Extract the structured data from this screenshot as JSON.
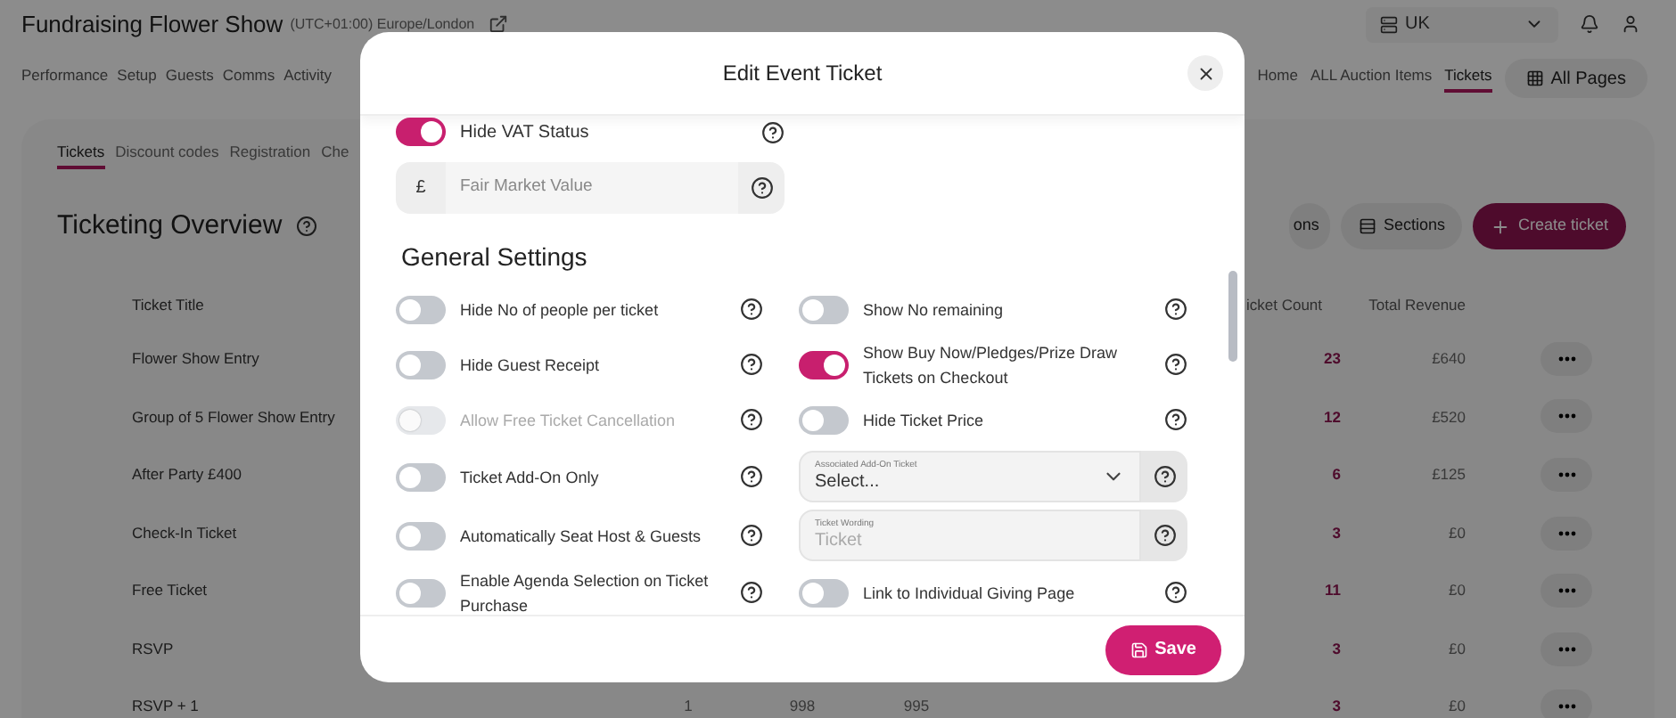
{
  "header": {
    "title": "Fundraising Flower Show",
    "timezone": "(UTC+01:00) Europe/London",
    "region": "UK"
  },
  "nav": [
    {
      "label": "Performance",
      "selected": false
    },
    {
      "label": "Setup",
      "selected": false
    },
    {
      "label": "Guests",
      "selected": false
    },
    {
      "label": "Comms",
      "selected": false
    },
    {
      "label": "Activity",
      "selected": false
    }
  ],
  "nav_right": [
    {
      "label": "Home",
      "selected": false
    },
    {
      "label": "ALL Auction Items",
      "selected": false
    },
    {
      "label": "Tickets",
      "selected": true
    }
  ],
  "all_pages": "All Pages",
  "sub_tabs": [
    {
      "label": "Tickets",
      "selected": true
    },
    {
      "label": "Discount codes",
      "selected": false
    },
    {
      "label": "Registration",
      "selected": false
    },
    {
      "label": "Che",
      "selected": false
    }
  ],
  "overview": {
    "title": "Ticketing Overview",
    "buttons": [
      {
        "label": "ons",
        "kind": "secondary"
      },
      {
        "label": "Sections",
        "kind": "secondary"
      },
      {
        "label": "Create ticket",
        "kind": "primary"
      }
    ]
  },
  "table": {
    "columns": [
      "Ticket Title",
      "icket Count",
      "Total Revenue"
    ],
    "rows": [
      {
        "title": "Flower Show Entry",
        "count": "23",
        "revenue": "£640"
      },
      {
        "title": "Group of 5 Flower Show Entry",
        "count": "12",
        "revenue": "£520"
      },
      {
        "title": "After Party £400",
        "count": "6",
        "revenue": "£125"
      },
      {
        "title": "Check-In Ticket",
        "count": "3",
        "revenue": "£0"
      },
      {
        "title": "Free Ticket",
        "count": "11",
        "revenue": "£0"
      },
      {
        "title": "RSVP",
        "count": "3",
        "revenue": "£0"
      },
      {
        "title": "RSVP + 1",
        "cells": [
          "1",
          "998",
          "995"
        ],
        "count": "3",
        "revenue": "£0"
      }
    ]
  },
  "modal": {
    "title": "Edit Event Ticket",
    "vat": {
      "label": "Hide VAT Status",
      "on": true
    },
    "fmv": {
      "prefix": "£",
      "placeholder": "Fair Market Value"
    },
    "section": "General Settings",
    "left": [
      {
        "label": "Hide No of people per ticket",
        "on": false,
        "disabled": false
      },
      {
        "label": "Hide Guest Receipt",
        "on": false,
        "disabled": false
      },
      {
        "label": "Allow Free Ticket Cancellation",
        "on": false,
        "disabled": true
      },
      {
        "label": "Ticket Add-On Only",
        "on": false,
        "disabled": false
      },
      {
        "label": "Automatically Seat Host & Guests",
        "on": false,
        "disabled": false
      },
      {
        "label": "Enable Agenda Selection on Ticket Purchase",
        "on": false,
        "disabled": false
      }
    ],
    "right": [
      {
        "kind": "toggle",
        "label": "Show No remaining",
        "on": false
      },
      {
        "kind": "toggle",
        "label": "Show Buy Now/Pledges/Prize Draw Tickets on Checkout",
        "on": true
      },
      {
        "kind": "toggle",
        "label": "Hide Ticket Price",
        "on": false
      },
      {
        "kind": "select",
        "label": "Associated Add-On Ticket",
        "value": "Select..."
      },
      {
        "kind": "text",
        "label": "Ticket Wording",
        "placeholder": "Ticket"
      },
      {
        "kind": "toggle",
        "label": "Link to Individual Giving Page",
        "on": false
      }
    ],
    "save": "Save"
  }
}
